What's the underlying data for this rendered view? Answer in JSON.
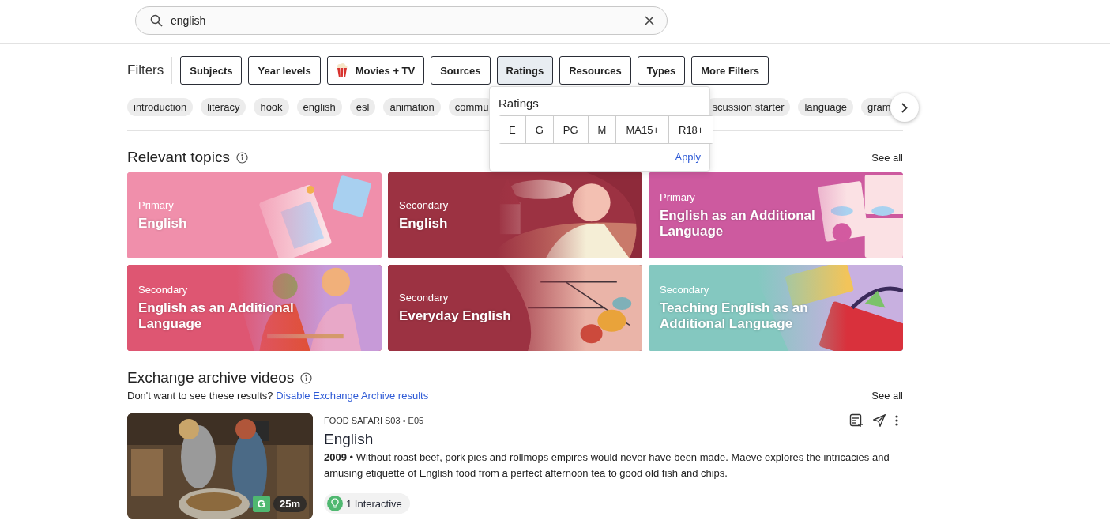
{
  "search": {
    "value": "english"
  },
  "filters": {
    "label": "Filters",
    "buttons": [
      {
        "label": "Subjects",
        "kind": "plain",
        "selected": false
      },
      {
        "label": "Year levels",
        "kind": "plain",
        "selected": false
      },
      {
        "label": "Movies + TV",
        "kind": "popcorn",
        "selected": false
      },
      {
        "label": "Sources",
        "kind": "plain",
        "selected": false
      },
      {
        "label": "Ratings",
        "kind": "plain",
        "selected": true
      },
      {
        "label": "Resources",
        "kind": "plain",
        "selected": false
      },
      {
        "label": "Types",
        "kind": "plain",
        "selected": false
      },
      {
        "label": "More Filters",
        "kind": "plain",
        "selected": false
      }
    ]
  },
  "tags": [
    "introduction",
    "literacy",
    "hook",
    "english",
    "esl",
    "animation",
    "commu",
    "scussion starter",
    "language",
    "gram"
  ],
  "ratings_popup": {
    "title": "Ratings",
    "options": [
      {
        "label": "E",
        "selected": false
      },
      {
        "label": "G",
        "selected": false
      },
      {
        "label": "PG",
        "selected": false
      },
      {
        "label": "M",
        "selected": false
      },
      {
        "label": "MA15+",
        "selected": false
      },
      {
        "label": "R18+",
        "selected": false
      }
    ],
    "apply": "Apply"
  },
  "relevant_topics": {
    "title": "Relevant topics",
    "see_all": "See all",
    "cards": [
      {
        "stage": "Primary",
        "title": "English",
        "color": "#f08fab"
      },
      {
        "stage": "Secondary",
        "title": "English",
        "color": "#9c3242"
      },
      {
        "stage": "Primary",
        "title": "English as an Additional Language",
        "color": "#cd5a9f"
      },
      {
        "stage": "Secondary",
        "title": "English as an Additional Language",
        "color": "#de5672"
      },
      {
        "stage": "Secondary",
        "title": "Everyday English",
        "color": "#9c3242"
      },
      {
        "stage": "Secondary",
        "title": "Teaching English as an Additional Language",
        "color": "#84c8c0"
      }
    ]
  },
  "exchange": {
    "title": "Exchange archive videos",
    "notice": "Don't want to see these results?",
    "link": "Disable Exchange Archive results",
    "see_all": "See all",
    "videos": [
      {
        "series": "FOOD SAFARI S03 • E05",
        "title": "English",
        "description": "**2009** • Without roast beef, pork pies and rollmops empires would never have been made. Maeve explores the intricacies and amusing etiquette of English food from a perfect afternoon tea to good old fish and chips.",
        "rating": "G",
        "duration": "25m",
        "interactive": "1 Interactive"
      }
    ]
  }
}
